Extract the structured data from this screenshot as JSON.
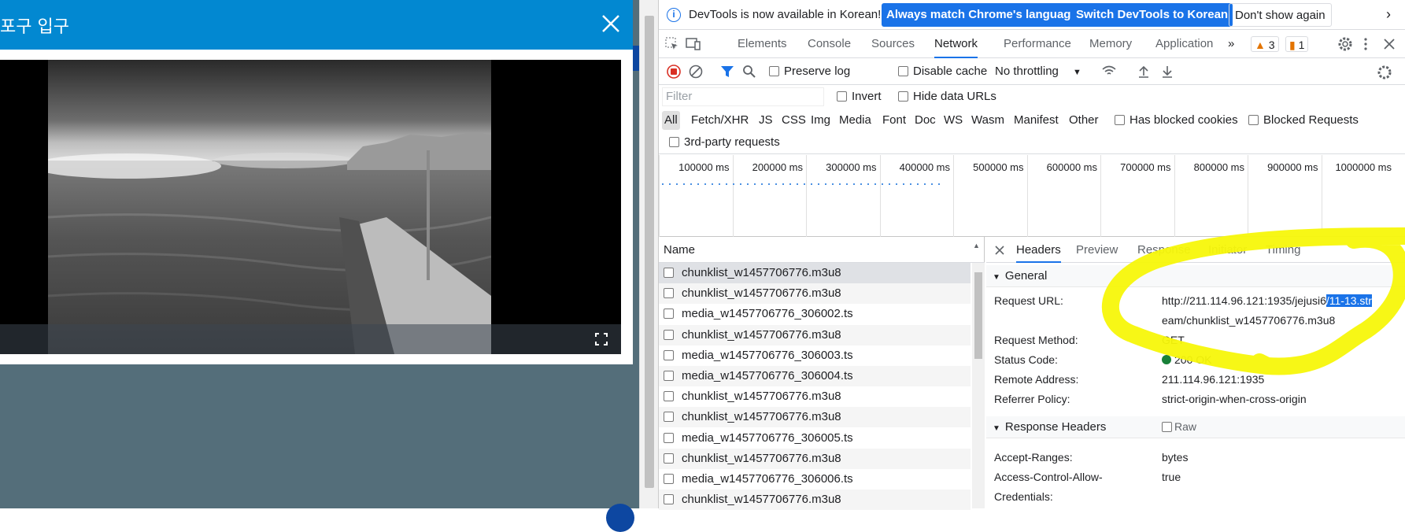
{
  "modal": {
    "title": "포구 입구",
    "close_label": "×"
  },
  "devtools": {
    "infobar": {
      "message": "DevTools is now available in Korean!",
      "btn_match": "Always match Chrome's language",
      "btn_switch": "Switch DevTools to Korean",
      "btn_dont": "Don't show again",
      "close": "×"
    },
    "tabs": [
      "Elements",
      "Console",
      "Sources",
      "Network",
      "Performance",
      "Memory",
      "Application"
    ],
    "active_tab": "Network",
    "more": "»",
    "warnings_count": "3",
    "issues_count": "1",
    "toolbar": {
      "preserve_log": "Preserve log",
      "disable_cache": "Disable cache",
      "throttling": "No throttling"
    },
    "filter": {
      "placeholder": "Filter",
      "invert": "Invert",
      "hide_data_urls": "Hide data URLs"
    },
    "types": [
      "All",
      "Fetch/XHR",
      "JS",
      "CSS",
      "Img",
      "Media",
      "Font",
      "Doc",
      "WS",
      "Wasm",
      "Manifest",
      "Other"
    ],
    "has_blocked_cookies": "Has blocked cookies",
    "blocked_requests": "Blocked Requests",
    "third_party": "3rd-party requests",
    "timeline_labels": [
      "100000 ms",
      "200000 ms",
      "300000 ms",
      "400000 ms",
      "500000 ms",
      "600000 ms",
      "700000 ms",
      "800000 ms",
      "900000 ms",
      "1000000 ms"
    ],
    "list_header": "Name",
    "requests": [
      "chunklist_w1457706776.m3u8",
      "chunklist_w1457706776.m3u8",
      "media_w1457706776_306002.ts",
      "chunklist_w1457706776.m3u8",
      "media_w1457706776_306003.ts",
      "media_w1457706776_306004.ts",
      "chunklist_w1457706776.m3u8",
      "chunklist_w1457706776.m3u8",
      "media_w1457706776_306005.ts",
      "chunklist_w1457706776.m3u8",
      "media_w1457706776_306006.ts",
      "chunklist_w1457706776.m3u8"
    ],
    "detail_tabs": [
      "Headers",
      "Preview",
      "Response",
      "Initiator",
      "Timing"
    ],
    "active_detail_tab": "Headers",
    "general": {
      "title": "General",
      "request_url_key": "Request URL:",
      "request_url_part1": "http://211.114.96.121:1935/jejusi6",
      "request_url_selected": "/11-13.str",
      "request_url_part2": "eam/chunklist_w1457706776.m3u8",
      "method_key": "Request Method:",
      "method_val": "GET",
      "status_key": "Status Code:",
      "status_val": "200 OK",
      "status_color": "#188038",
      "remote_key": "Remote Address:",
      "remote_val": "211.114.96.121:1935",
      "referrer_key": "Referrer Policy:",
      "referrer_val": "strict-origin-when-cross-origin"
    },
    "response_headers": {
      "title": "Response Headers",
      "raw": "Raw",
      "accept_ranges_key": "Accept-Ranges:",
      "accept_ranges_val": "bytes",
      "acac_key1": "Access-Control-Allow-",
      "acac_key2": "Credentials:",
      "acac_val": "true"
    }
  },
  "colors": {
    "modal_header": "#0288d1",
    "page_bg": "#546e7a",
    "annotation": "#f7f70a",
    "accent": "#1a73e8"
  }
}
